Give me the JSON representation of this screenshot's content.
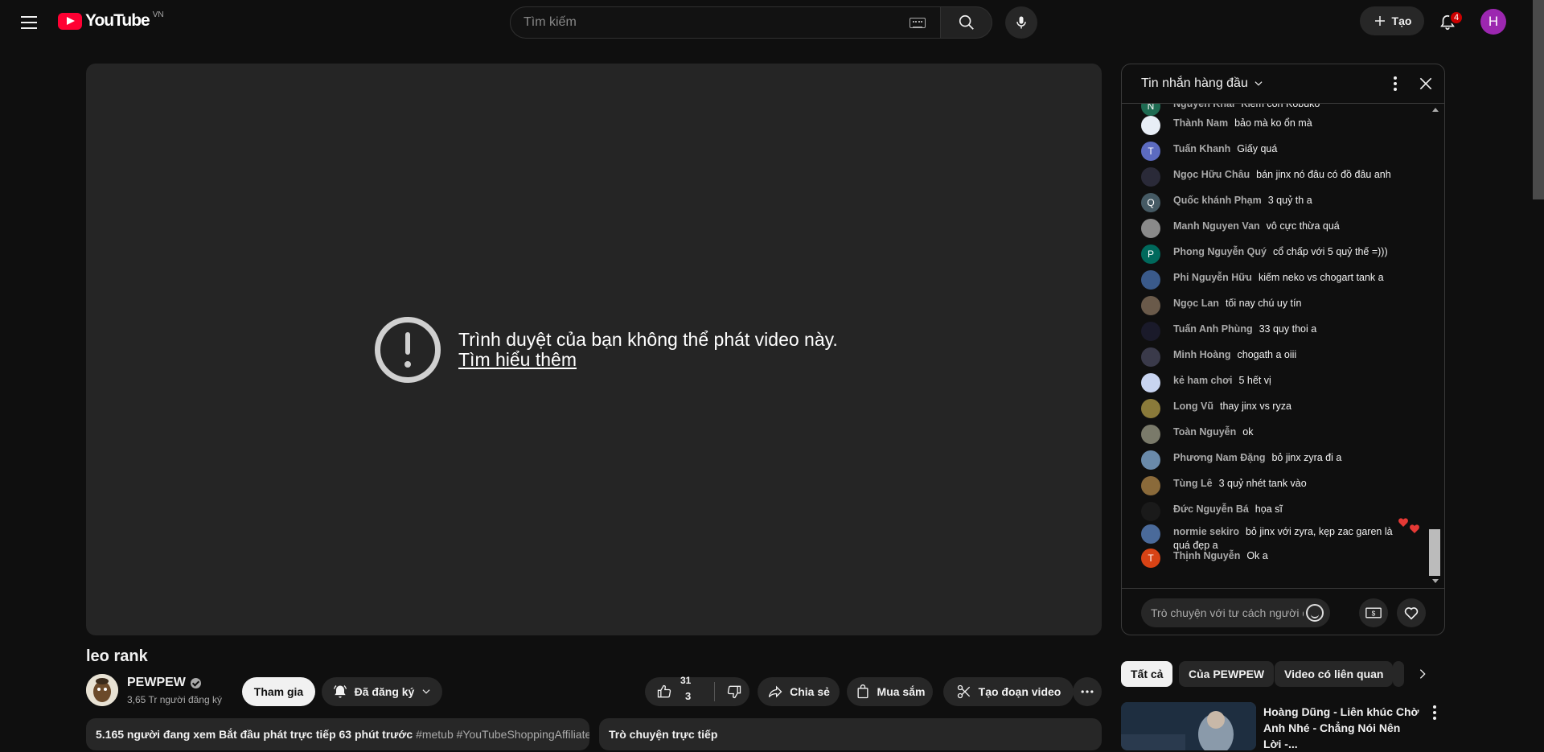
{
  "header": {
    "logo_text": "YouTube",
    "logo_region": "VN",
    "search_placeholder": "Tìm kiếm",
    "create_label": "Tạo",
    "notifications_count": "4",
    "user_initial": "H"
  },
  "player": {
    "error_message": "Trình duyệt của bạn không thể phát video này.",
    "learn_more": "Tìm hiểu thêm"
  },
  "video": {
    "title": "leo rank",
    "channel_name": "PEWPEW",
    "subscribers": "3,65 Tr người đăng ký",
    "join_label": "Tham gia",
    "subscribed_label": "Đã đăng ký",
    "like_count_top": "31",
    "like_count_mid": "3",
    "share_label": "Chia sẻ",
    "shop_label": "Mua sắm",
    "clip_label": "Tạo đoạn video",
    "description_text": "5.165 người đang xem  Bắt đầu phát trực tiếp 63 phút trước ",
    "description_tags": "#metub #YouTubeShoppingAffiliate",
    "live_chat_label": "Trò chuyện trực tiếp"
  },
  "chat": {
    "title": "Tin nhắn hàng đầu",
    "input_placeholder": "Trò chuyện với tư cách người đ...",
    "messages": [
      {
        "author": "Nguyễn Khải",
        "text": "Kiếm con Kobuko",
        "avatar": "N",
        "color": "#1e6b52"
      },
      {
        "author": "Thành Nam",
        "text": "bảo mà ko ổn mà",
        "avatar": "",
        "color": "#e8eef6"
      },
      {
        "author": "Tuấn Khanh",
        "text": "Giấy quá",
        "avatar": "T",
        "color": "#5c6bc0"
      },
      {
        "author": "Ngọc Hữu Châu",
        "text": "bán jinx nó đâu có đồ đâu anh",
        "avatar": "",
        "color": "#2a2a38"
      },
      {
        "author": "Quốc khánh Phạm",
        "text": "3 quỷ th a",
        "avatar": "Q",
        "color": "#455a64"
      },
      {
        "author": "Manh Nguyen Van",
        "text": "vô cực thừa quá",
        "avatar": "",
        "color": "#8a8a8a"
      },
      {
        "author": "Phong Nguyễn Quý",
        "text": "cổ chấp với 5 quỷ thế =)))",
        "avatar": "P",
        "color": "#00695c"
      },
      {
        "author": "Phi Nguyễn Hữu",
        "text": "kiếm neko vs chogart tank a",
        "avatar": "",
        "color": "#3a5a8a"
      },
      {
        "author": "Ngọc Lan",
        "text": "tối nay chú uy tín",
        "avatar": "",
        "color": "#6a5a4a"
      },
      {
        "author": "Tuấn Anh Phùng",
        "text": "33 quy thoi a",
        "avatar": "",
        "color": "#1a1a2a"
      },
      {
        "author": "Minh Hoàng",
        "text": "chogath a oiii",
        "avatar": "",
        "color": "#3a3a4a"
      },
      {
        "author": "kẻ ham chơi",
        "text": "5 hết vị",
        "avatar": "",
        "color": "#c8d4f0"
      },
      {
        "author": "Long Vũ",
        "text": "thay jinx vs ryza",
        "avatar": "",
        "color": "#8a7a3a"
      },
      {
        "author": "Toàn Nguyễn",
        "text": "ok",
        "avatar": "",
        "color": "#7a7a6a"
      },
      {
        "author": "Phương Nam Đặng",
        "text": "bỏ jinx zyra đi a",
        "avatar": "",
        "color": "#6a8aaa"
      },
      {
        "author": "Tùng Lê",
        "text": "3 quỷ nhét tank vào",
        "avatar": "",
        "color": "#8a6a3a"
      },
      {
        "author": "Đức Nguyễn Bá",
        "text": "họa sĩ",
        "avatar": "",
        "color": "#1a1a1a"
      },
      {
        "author": "normie sekiro",
        "text": "bỏ jinx với zyra, kẹp zac garen là quá đẹp a",
        "avatar": "",
        "color": "#4a6a9a"
      },
      {
        "author": "Thịnh Nguyễn",
        "text": "Ok a",
        "avatar": "T",
        "color": "#d84315"
      }
    ]
  },
  "chips": [
    "Tất cả",
    "Của PEWPEW",
    "Video có liên quan"
  ],
  "recommendation": {
    "title": "Hoàng Dũng - Liên khúc Chờ Anh Nhé - Chẳng Nói Nên Lời -..."
  }
}
